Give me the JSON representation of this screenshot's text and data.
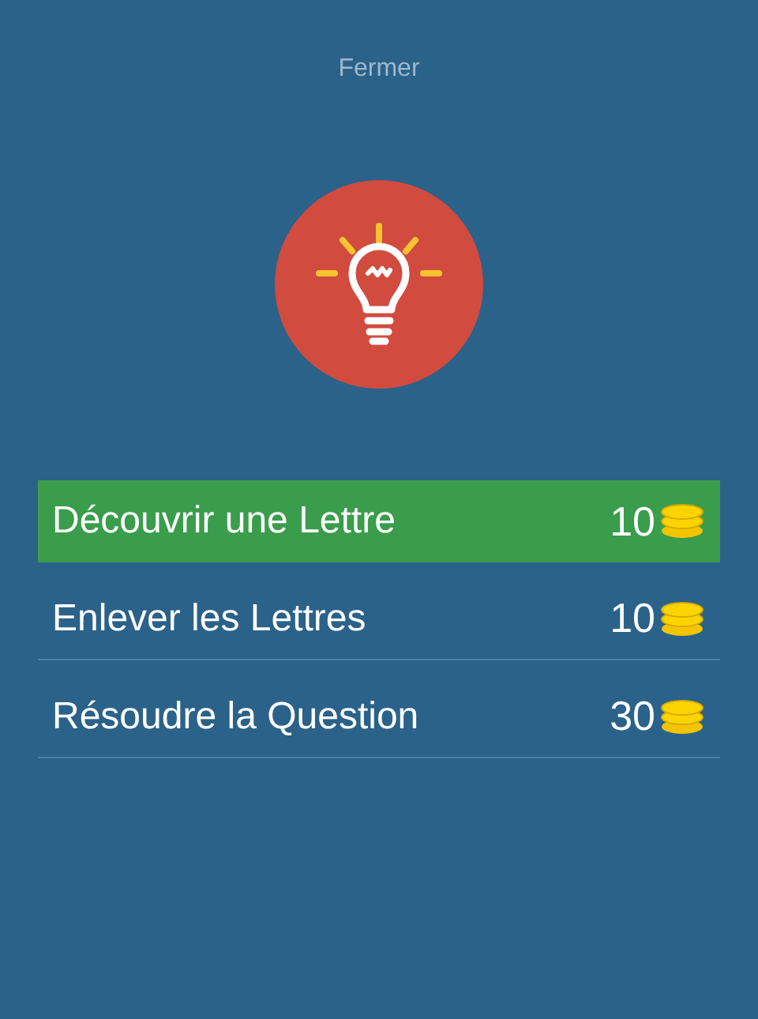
{
  "close_link": "Fermer",
  "options": [
    {
      "label": "Découvrir une Lettre",
      "cost": "10",
      "selected": true
    },
    {
      "label": "Enlever les Lettres",
      "cost": "10",
      "selected": false
    },
    {
      "label": "Résoudre la Question",
      "cost": "30",
      "selected": false
    }
  ]
}
